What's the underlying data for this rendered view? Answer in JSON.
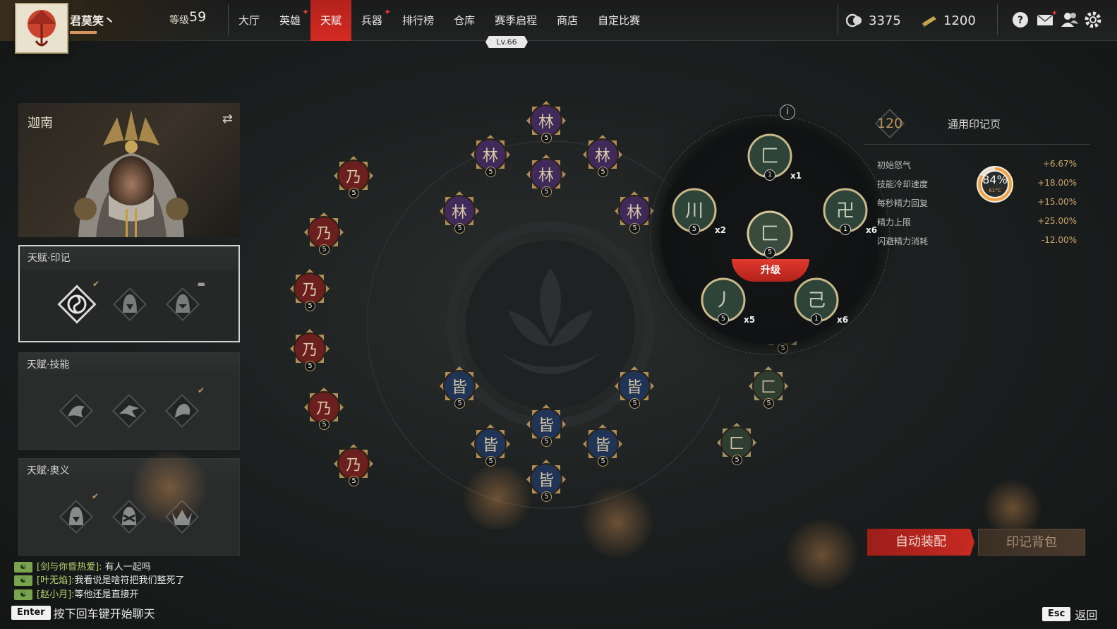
{
  "player": {
    "name": "君莫笑丶",
    "level_label": "等级",
    "level": "59"
  },
  "nav": {
    "items": [
      {
        "label": "大厅",
        "alert": false
      },
      {
        "label": "英雄",
        "alert": true
      },
      {
        "label": "天赋",
        "alert": false
      },
      {
        "label": "兵器",
        "alert": true
      },
      {
        "label": "排行榜",
        "alert": false
      },
      {
        "label": "仓库",
        "alert": false
      },
      {
        "label": "赛季启程",
        "alert": false
      },
      {
        "label": "商店",
        "alert": false
      },
      {
        "label": "自定比赛",
        "alert": false
      }
    ],
    "active": "天赋",
    "season_level": "Lv.66"
  },
  "currency": {
    "coins": "3375",
    "gold": "1200"
  },
  "colors": {
    "accent_red": "#d42b22",
    "gold": "#b6965e",
    "stat_value": "#c9a56a",
    "chat_name": "#b7d46b"
  },
  "hero": {
    "name": "迦南",
    "swap_icon": "swap-icon"
  },
  "sections": [
    {
      "title": "天赋·印记",
      "selected": true
    },
    {
      "title": "天赋·技能",
      "selected": false
    },
    {
      "title": "天赋·奥义",
      "selected": false
    }
  ],
  "tree_nodes": [
    {
      "color": "red",
      "level": "5"
    },
    {
      "color": "red",
      "level": "5"
    },
    {
      "color": "red",
      "level": "5"
    },
    {
      "color": "red",
      "level": "5"
    },
    {
      "color": "red",
      "level": "5"
    },
    {
      "color": "red",
      "level": "5"
    },
    {
      "color": "purple",
      "level": "5"
    },
    {
      "color": "purple",
      "level": "5"
    },
    {
      "color": "purple",
      "level": "5"
    },
    {
      "color": "purple",
      "level": "5"
    },
    {
      "color": "purple",
      "level": "5"
    },
    {
      "color": "purple",
      "level": "5"
    },
    {
      "color": "blue",
      "level": "5"
    },
    {
      "color": "blue",
      "level": "5"
    },
    {
      "color": "blue",
      "level": "5"
    },
    {
      "color": "blue",
      "level": "5"
    },
    {
      "color": "blue",
      "level": "5"
    },
    {
      "color": "blue",
      "level": "5"
    },
    {
      "color": "green",
      "level": "5"
    },
    {
      "color": "green",
      "level": "5"
    },
    {
      "color": "green",
      "level": "5"
    }
  ],
  "radial": {
    "upgrade_label": "升级",
    "center": {
      "level": "5"
    },
    "nodes": [
      {
        "level": "1",
        "mult": "x1"
      },
      {
        "level": "5",
        "mult": "x2"
      },
      {
        "level": "1",
        "mult": "x6"
      },
      {
        "level": "5",
        "mult": "x5"
      },
      {
        "level": "1",
        "mult": "x6"
      }
    ]
  },
  "stats_panel": {
    "page_count": "120",
    "page_title": "通用印记页",
    "stats": [
      {
        "name": "初始怒气",
        "value": "+6.67%"
      },
      {
        "name": "技能冷却速度",
        "value": "+18.00%"
      },
      {
        "name": "每秒精力回复",
        "value": "+15.00%"
      },
      {
        "name": "精力上限",
        "value": "+25.00%"
      },
      {
        "name": "闪避精力消耗",
        "value": "-12.00%"
      }
    ],
    "gauge": {
      "value": "84%",
      "fraction": 0.84,
      "temp": "61°C"
    }
  },
  "buttons": {
    "auto_equip": "自动装配",
    "mark_bag": "印记背包"
  },
  "chat": {
    "channel_icon": "chat-channel-icon",
    "messages": [
      {
        "who": "[剑与你昏热爱]:",
        "text": " 有人一起吗"
      },
      {
        "who": "[叶无焰]:",
        "text": "我看说是啥符把我们整死了"
      },
      {
        "who": "[赵小月]:",
        "text": "等他还是直接开"
      }
    ],
    "enter_key": "Enter",
    "hint": "按下回车键开始聊天"
  },
  "footer": {
    "esc_key": "Esc",
    "back_label": "返回"
  }
}
